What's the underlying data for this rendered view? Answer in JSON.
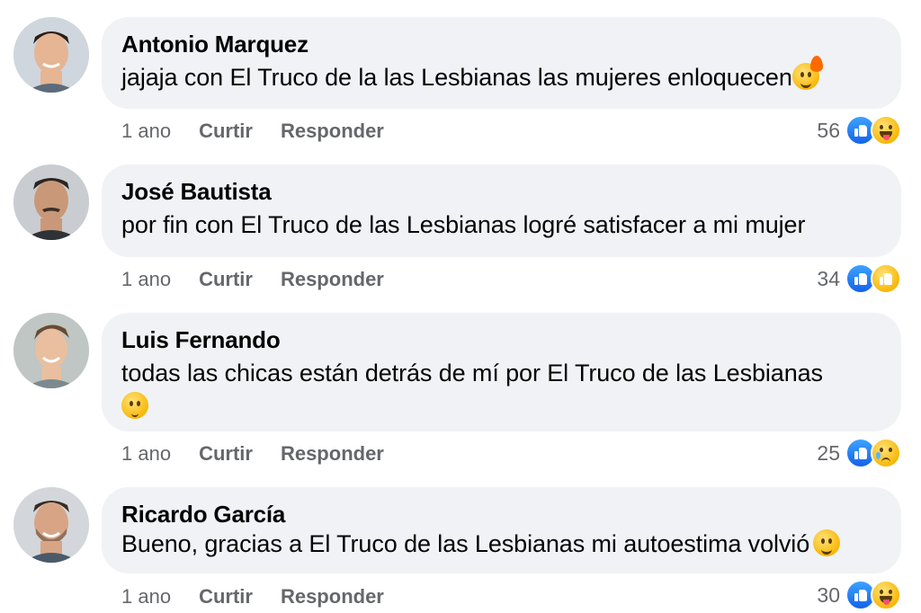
{
  "comments": [
    {
      "author": "Antonio Marquez",
      "text": "jajaja con El Truco de la las Lesbianas las mujeres enloquecen",
      "emoji": "fire-face-emoji",
      "time": "1 ano",
      "like_label": "Curtir",
      "reply_label": "Responder",
      "reaction_count": "56",
      "reactions": [
        "like",
        "haha"
      ]
    },
    {
      "author": "José Bautista",
      "text": "por fin con El Truco de las Lesbianas logré satisfacer a mi mujer",
      "emoji": "",
      "time": "1 ano",
      "like_label": "Curtir",
      "reply_label": "Responder",
      "reaction_count": "34",
      "reactions": [
        "like",
        "care"
      ]
    },
    {
      "author": "Luis Fernando",
      "text": "todas las chicas están detrás de mí por El Truco de las Lesbianas",
      "emoji": "pleading-face-emoji",
      "time": "1 ano",
      "like_label": "Curtir",
      "reply_label": "Responder",
      "reaction_count": "25",
      "reactions": [
        "like",
        "sad"
      ]
    },
    {
      "author": "Ricardo García",
      "text": "Bueno, gracias a El Truco de las Lesbianas mi autoestima volvió",
      "emoji": "smiling-face-emoji",
      "time": "1 ano",
      "like_label": "Curtir",
      "reply_label": "Responder",
      "reaction_count": "30",
      "reactions": [
        "like",
        "haha"
      ]
    }
  ],
  "colors": {
    "bubble_bg": "#f0f2f5",
    "meta_text": "#65676b",
    "like_blue": "#1877f2"
  }
}
